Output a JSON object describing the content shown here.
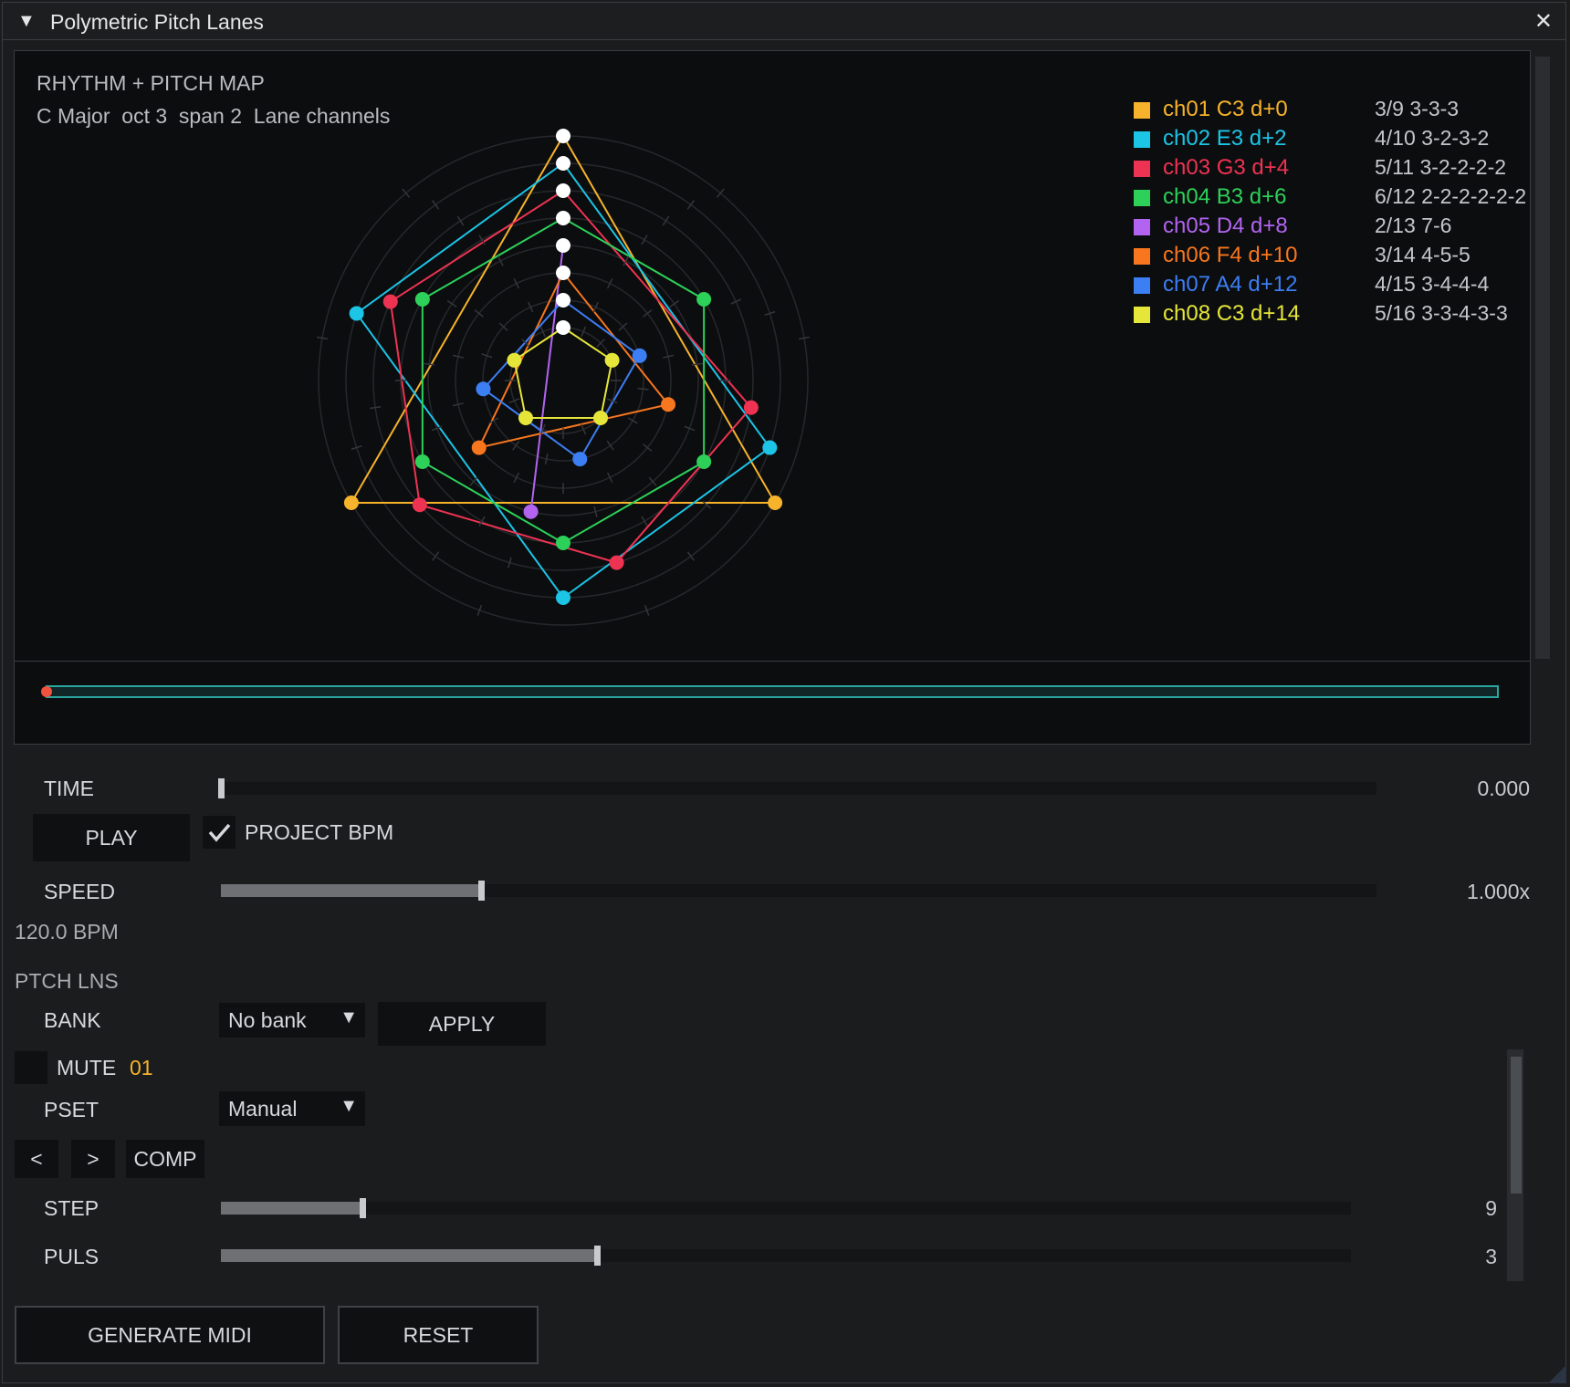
{
  "window": {
    "title": "Polymetric Pitch Lanes",
    "close_glyph": "✕",
    "collapse_glyph": "▼"
  },
  "viz": {
    "title": "RHYTHM + PITCH MAP",
    "subtitle": "C Major  oct 3  span 2  Lane channels",
    "legend": [
      {
        "label": "ch01 C3 d+0",
        "pattern": "3/9 3-3-3",
        "color": "#f6b32b"
      },
      {
        "label": "ch02 E3 d+2",
        "pattern": "4/10 3-2-3-2",
        "color": "#1cc4e6"
      },
      {
        "label": "ch03 G3 d+4",
        "pattern": "5/11 3-2-2-2-2",
        "color": "#ee3352"
      },
      {
        "label": "ch04 B3 d+6",
        "pattern": "6/12 2-2-2-2-2-2",
        "color": "#2dd159"
      },
      {
        "label": "ch05 D4 d+8",
        "pattern": "2/13 7-6",
        "color": "#b264f0"
      },
      {
        "label": "ch06 F4 d+10",
        "pattern": "3/14 4-5-5",
        "color": "#f7761e"
      },
      {
        "label": "ch07 A4 d+12",
        "pattern": "4/15 3-4-4-4",
        "color": "#3c7ef3"
      },
      {
        "label": "ch08 C3 d+14",
        "pattern": "5/16 3-3-4-3-3",
        "color": "#e6e63a"
      }
    ]
  },
  "timeline": {
    "progress": 0.0
  },
  "controls": {
    "time_label": "TIME",
    "time_value": "0.000",
    "time_fraction": 0.0,
    "play_label": "PLAY",
    "project_bpm_label": "PROJECT BPM",
    "project_bpm_checked": true,
    "speed_label": "SPEED",
    "speed_value": "1.000x",
    "speed_fraction": 0.225,
    "bpm_text": "120.0 BPM",
    "section_label": "PTCH LNS",
    "bank_label": "BANK",
    "bank_value": "No bank",
    "apply_label": "APPLY",
    "mute_label": "MUTE",
    "mute_channel": "01",
    "pset_label": "PSET",
    "pset_value": "Manual",
    "prev_label": "<",
    "next_label": ">",
    "comp_label": "COMP",
    "step_label": "STEP",
    "step_value": "9",
    "step_fraction": 0.125,
    "puls_label": "PULS",
    "puls_value": "3",
    "puls_fraction": 0.333
  },
  "footer": {
    "generate_label": "GENERATE MIDI",
    "reset_label": "RESET"
  },
  "icons": {
    "dropdown": "dropdown-arrow-icon",
    "check": "checkmark-icon"
  }
}
